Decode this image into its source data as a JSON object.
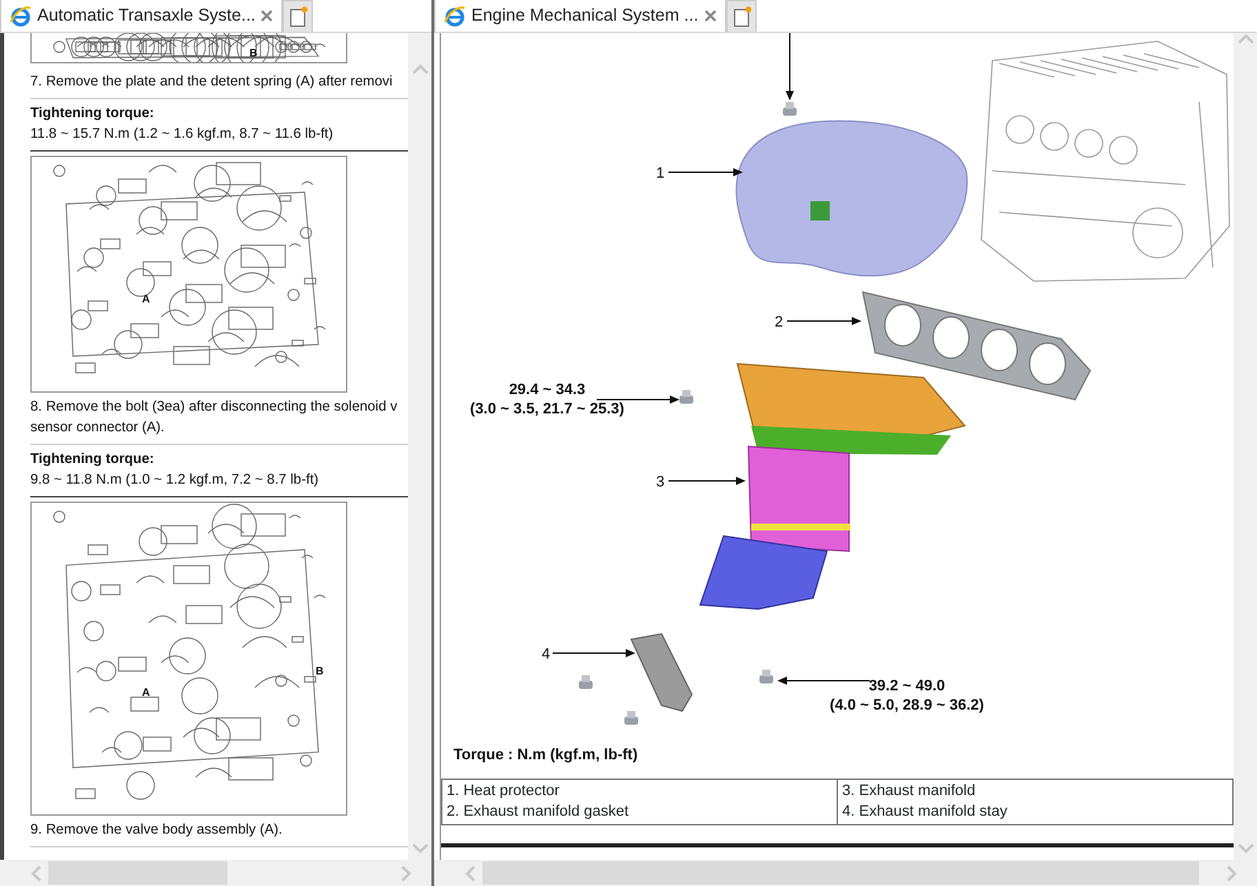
{
  "panes": [
    {
      "tab_title": "Automatic Transaxle Syste...",
      "content": [
        {
          "kind": "figure",
          "labels": [
            "B"
          ]
        },
        {
          "kind": "step",
          "lines": [
            "7. Remove the plate and the detent spring (A) after removi"
          ]
        },
        {
          "kind": "torque",
          "heading": "Tightening torque:",
          "value": "11.8 ~ 15.7 N.m (1.2 ~ 1.6 kgf.m, 8.7 ~ 11.6 lb-ft)"
        },
        {
          "kind": "figure",
          "labels": [
            "A"
          ]
        },
        {
          "kind": "step",
          "lines": [
            "8. Remove the bolt (3ea) after disconnecting the solenoid v",
            "sensor connector (A)."
          ]
        },
        {
          "kind": "torque",
          "heading": "Tightening torque:",
          "value": "9.8 ~ 11.8 N.m (1.0 ~ 1.2 kgf.m, 7.2 ~ 8.7 lb-ft)"
        },
        {
          "kind": "figure",
          "labels": [
            "A",
            "B"
          ]
        },
        {
          "kind": "step",
          "lines": [
            "9. Remove the valve body assembly (A)."
          ]
        }
      ]
    },
    {
      "tab_title": "Engine Mechanical System ...",
      "figure": {
        "callouts": [
          "1",
          "2",
          "3",
          "4"
        ],
        "torque_labels": [
          {
            "value": "29.4 ~ 34.3",
            "detail": "(3.0 ~ 3.5, 21.7 ~ 25.3)"
          },
          {
            "value": "39.2 ~ 49.0",
            "detail": "(4.0 ~ 5.0, 28.9 ~ 36.2)"
          }
        ],
        "caption": "Torque : N.m (kgf.m, lb-ft)"
      },
      "legend": [
        [
          "1. Heat protector",
          "2. Exhaust manifold gasket"
        ],
        [
          "3. Exhaust manifold",
          "4. Exhaust manifold stay"
        ]
      ]
    }
  ]
}
